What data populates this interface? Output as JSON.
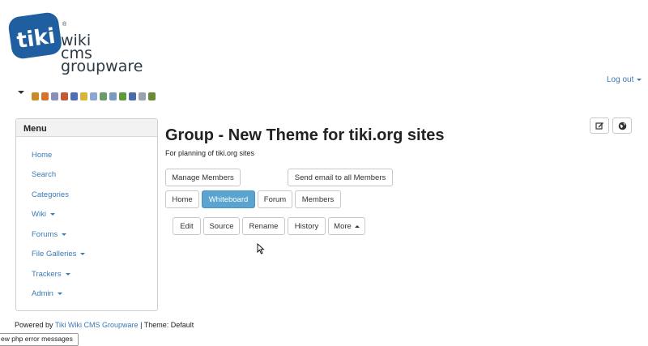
{
  "logo": {
    "line1": "wiki",
    "line2": "cms",
    "line3": "groupware",
    "reg": "®",
    "brand_color": "#1f5fa0"
  },
  "toolbar": {
    "icons": [
      "wrench-icon",
      "home-icon",
      "pencil-icon",
      "users-icon",
      "user-icon",
      "key-icon",
      "table-icon",
      "image-icon",
      "image2-icon",
      "puzzle-icon",
      "document-icon",
      "card-icon",
      "leaf-icon"
    ]
  },
  "header": {
    "logout": "Log out"
  },
  "menu": {
    "title": "Menu",
    "items": [
      {
        "label": "Home",
        "dropdown": false
      },
      {
        "label": "Search",
        "dropdown": false
      },
      {
        "label": "Categories",
        "dropdown": false
      },
      {
        "label": "Wiki",
        "dropdown": true
      },
      {
        "label": "Forums",
        "dropdown": true
      },
      {
        "label": "File Galleries",
        "dropdown": true
      },
      {
        "label": "Trackers",
        "dropdown": true
      },
      {
        "label": "Admin",
        "dropdown": true
      }
    ]
  },
  "page": {
    "title": "Group - New Theme for tiki.org sites",
    "description": "For planning of tiki.org sites",
    "manage_members": "Manage Members",
    "send_email": "Send email to all Members",
    "nav_tabs": [
      {
        "label": "Home",
        "active": false
      },
      {
        "label": "Whiteboard",
        "active": true
      },
      {
        "label": "Forum",
        "active": false
      },
      {
        "label": "Members",
        "active": false
      }
    ],
    "actions": {
      "edit": "Edit",
      "source": "Source",
      "rename": "Rename",
      "history": "History",
      "more": "More"
    }
  },
  "footer": {
    "prefix": "Powered by",
    "link": "Tiki Wiki CMS Groupware",
    "separator": "|",
    "theme": "Theme: Default"
  },
  "tooltip": "ew php error messages",
  "colors": {
    "link": "#3b7ab5",
    "active_tab": "#5ba4d0"
  }
}
